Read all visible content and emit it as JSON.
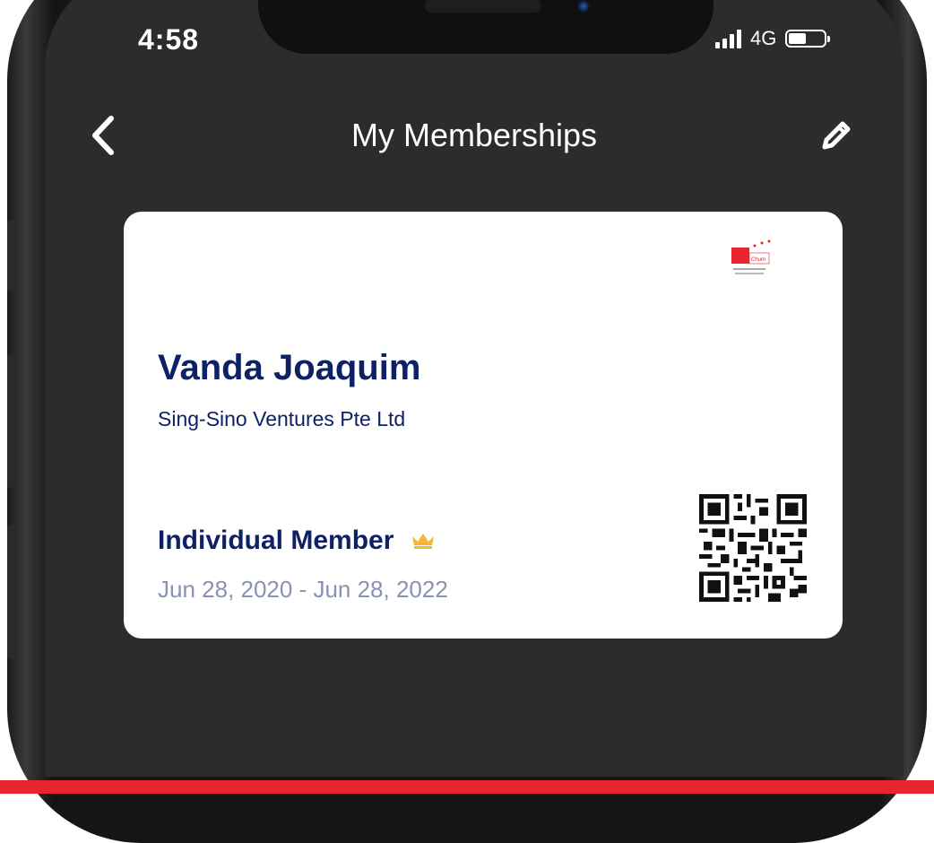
{
  "status_bar": {
    "time": "4:58",
    "network": "4G",
    "battery_level": 0.5,
    "signal_bars": 3
  },
  "nav": {
    "back_icon": "chevron-left-icon",
    "title": "My Memberships",
    "edit_icon": "pencil-icon"
  },
  "card": {
    "logo_text": "Chum",
    "name": "Vanda Joaquim",
    "company": "Sing-Sino Ventures Pte Ltd",
    "tier": "Individual Member",
    "tier_icon": "crown-icon",
    "dates": "Jun 28, 2020 - Jun 28, 2022",
    "qr_icon": "qr-code-icon"
  },
  "colors": {
    "screen_bg": "#2c2c2c",
    "card_bg": "#ffffff",
    "name_color": "#0f2166",
    "date_color": "#8991b5",
    "crown_color": "#f5b82e",
    "accent_bar": "#e8242f"
  }
}
